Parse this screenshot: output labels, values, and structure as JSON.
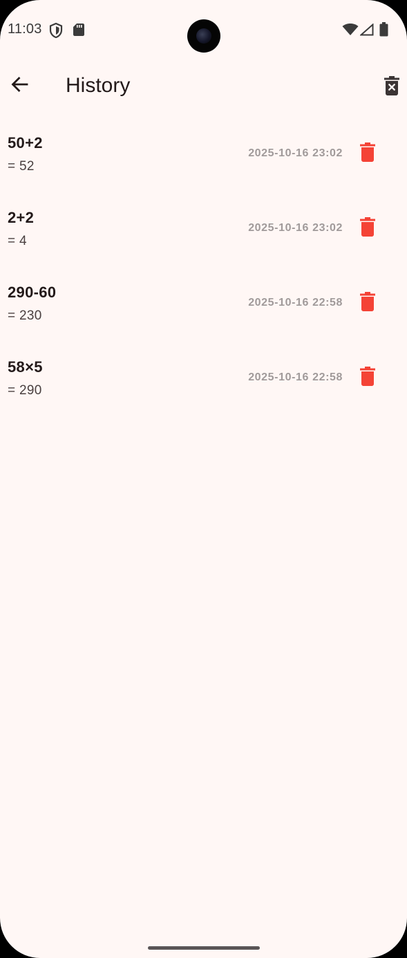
{
  "status_bar": {
    "time": "11:03",
    "icons_left": [
      "shield-icon",
      "sd-card-icon"
    ],
    "icons_right": [
      "wifi-icon",
      "signal-icon",
      "battery-icon"
    ]
  },
  "app_bar": {
    "title": "History",
    "back_icon": "arrow-left-icon",
    "clear_icon": "delete-sweep-icon"
  },
  "colors": {
    "background": "#FFF7F5",
    "delete_red": "#F44336",
    "timestamp_gray": "#A09A9A",
    "text_dark": "#231A1A"
  },
  "history": [
    {
      "expression": "50+2",
      "result": "= 52",
      "timestamp": "2025-10-16 23:02"
    },
    {
      "expression": "2+2",
      "result": "= 4",
      "timestamp": "2025-10-16 23:02"
    },
    {
      "expression": "290-60",
      "result": "= 230",
      "timestamp": "2025-10-16 22:58"
    },
    {
      "expression": "58×5",
      "result": "= 290",
      "timestamp": "2025-10-16 22:58"
    }
  ]
}
